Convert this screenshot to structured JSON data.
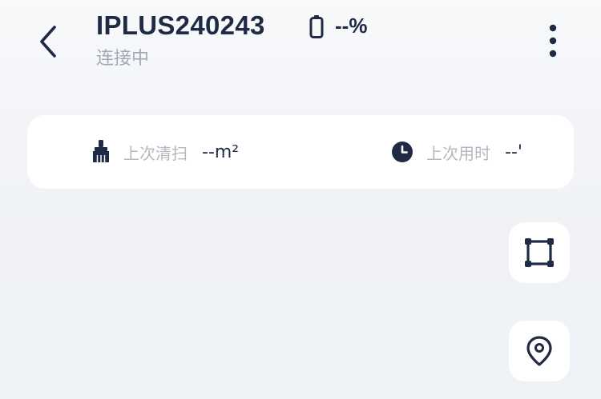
{
  "header": {
    "device_name": "IPLUS240243",
    "status": "连接中",
    "battery_text": "--%",
    "back_icon": "chevron-left-icon",
    "battery_icon": "battery-icon",
    "more_icon": "more-vertical-icon"
  },
  "stats": {
    "area_label": "上次清扫",
    "area_value": "--m²",
    "area_icon": "brush-icon",
    "time_label": "上次用时",
    "time_value": "--'",
    "time_icon": "clock-icon"
  },
  "fabs": [
    {
      "name": "area-select",
      "icon": "square-frame-icon"
    },
    {
      "name": "location",
      "icon": "location-pin-icon"
    }
  ],
  "colors": {
    "primary_text": "#1f2a44",
    "muted_text": "#a3a9b3",
    "card_bg": "#ffffff",
    "page_bg": "#f1f3f7"
  }
}
